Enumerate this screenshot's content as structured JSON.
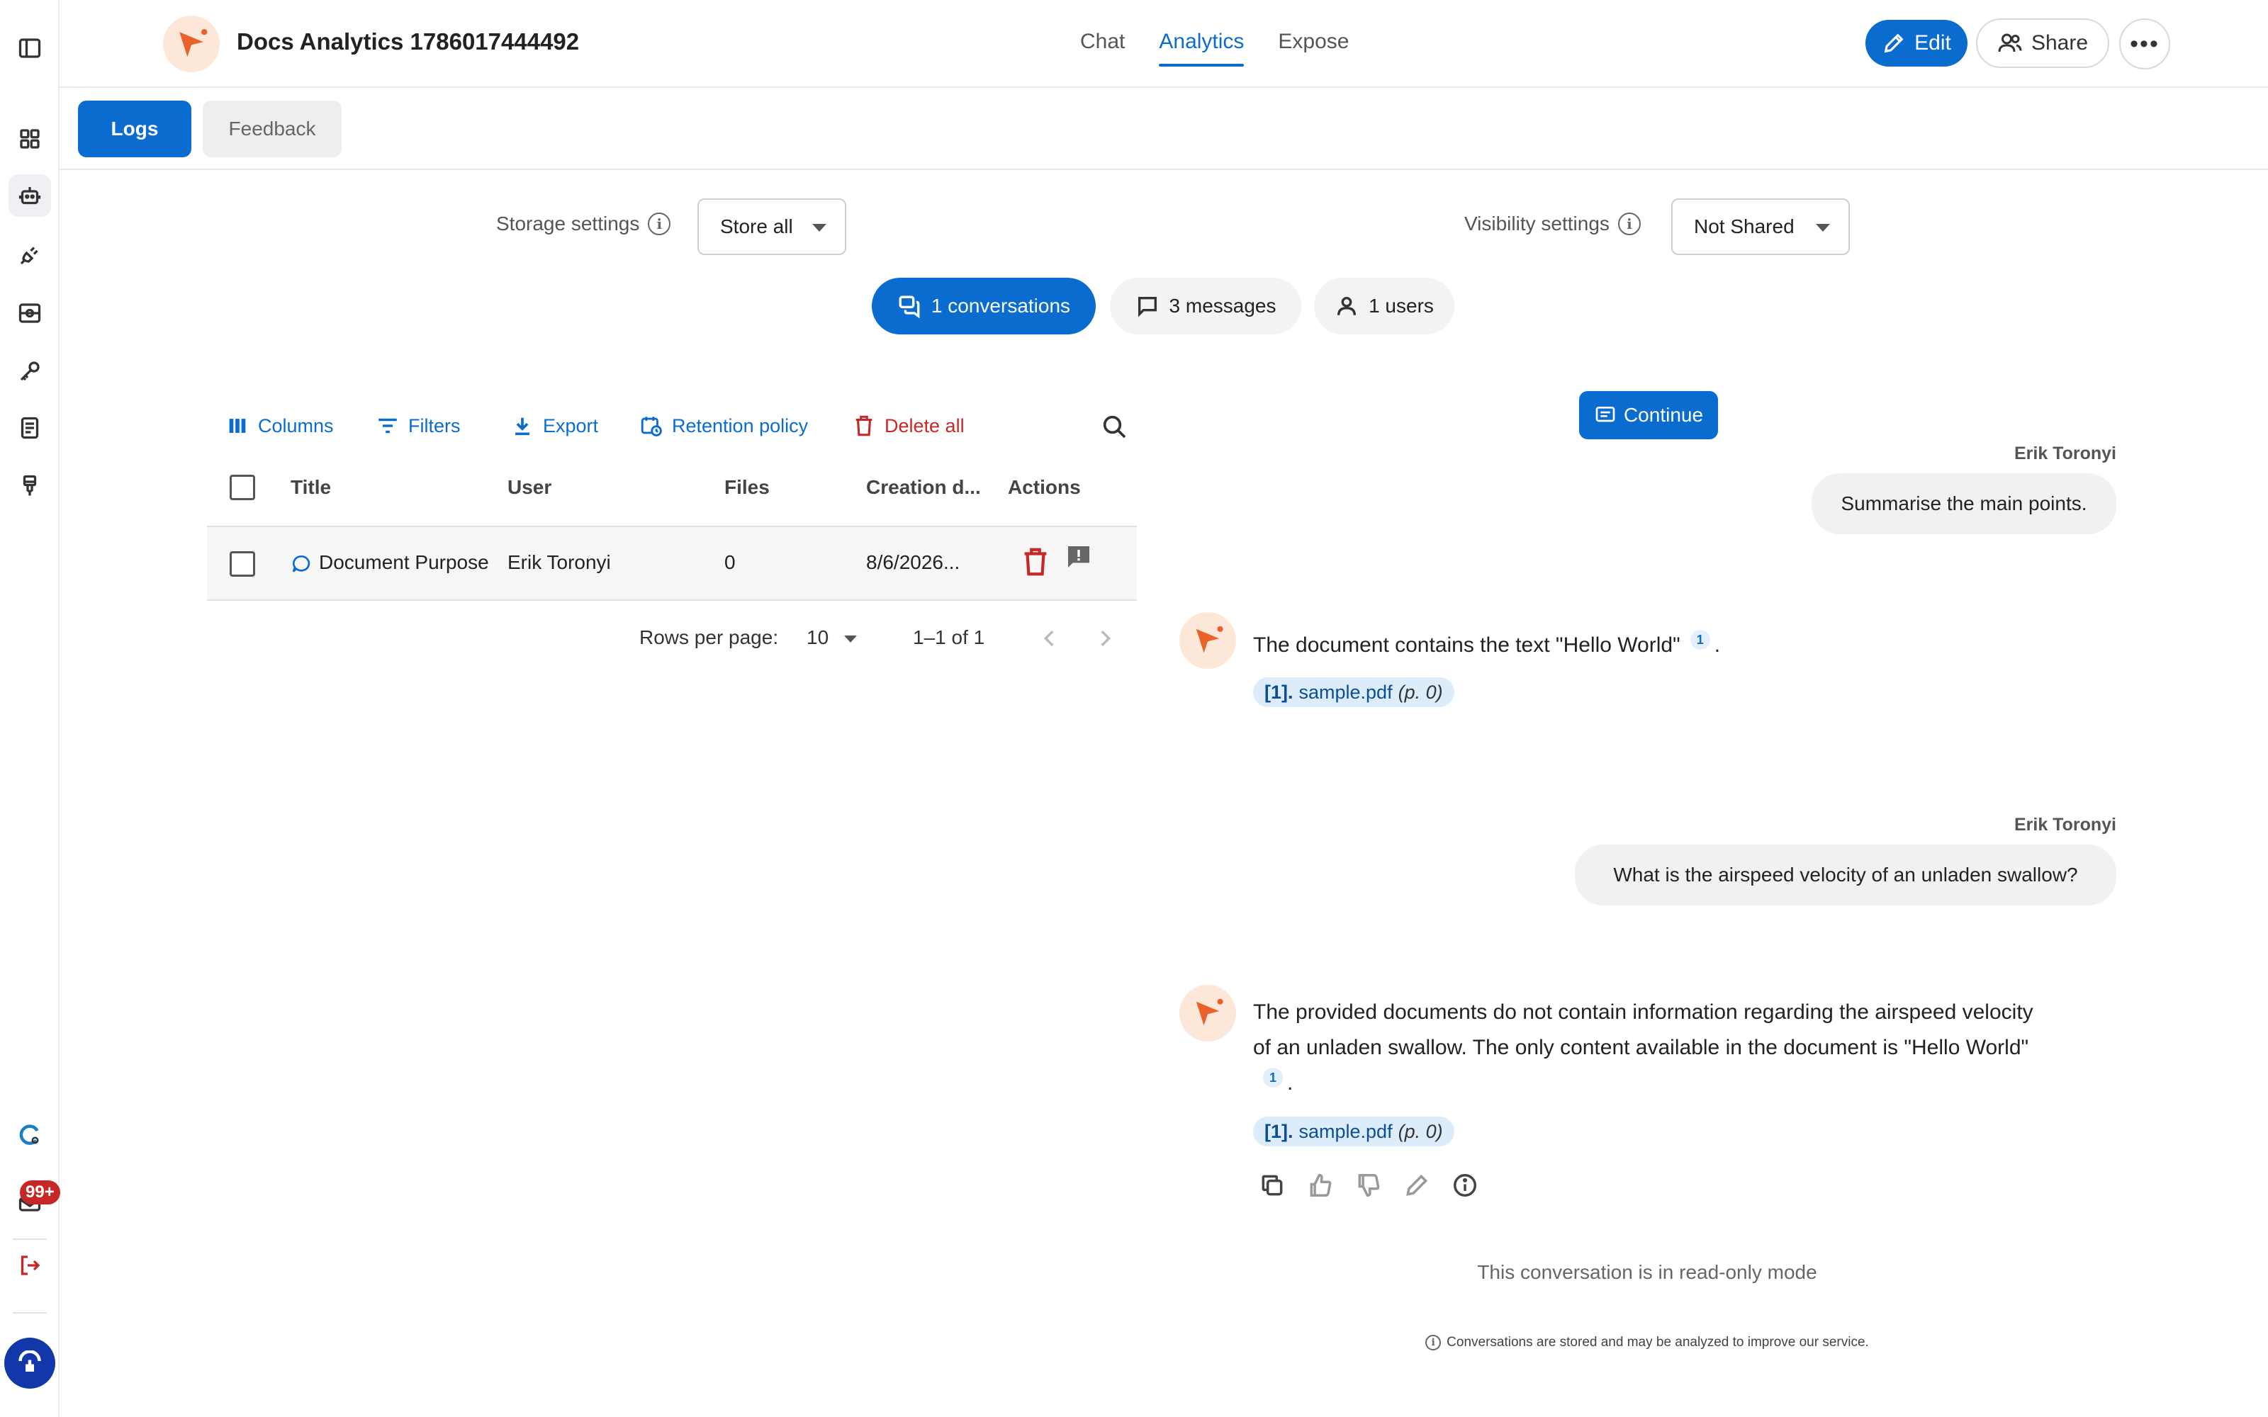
{
  "app": {
    "title": "Docs Analytics 1786017444492",
    "nav_tabs": [
      {
        "label": "Chat"
      },
      {
        "label": "Analytics",
        "active": true
      },
      {
        "label": "Expose"
      }
    ],
    "edit_label": "Edit",
    "share_label": "Share"
  },
  "rail": {
    "notification_badge": "99+"
  },
  "subtabs": {
    "logs": "Logs",
    "feedback": "Feedback"
  },
  "settings": {
    "storage_label": "Storage settings",
    "storage_value": "Store all",
    "visibility_label": "Visibility settings",
    "visibility_value": "Not Shared"
  },
  "stats": {
    "conversations": "1 conversations",
    "messages": "3 messages",
    "users": "1 users"
  },
  "toolbar": {
    "columns": "Columns",
    "filters": "Filters",
    "export": "Export",
    "retention": "Retention policy",
    "delete_all": "Delete all"
  },
  "table": {
    "headers": {
      "title": "Title",
      "user": "User",
      "files": "Files",
      "creation": "Creation d...",
      "actions": "Actions"
    },
    "rows": [
      {
        "title": "Document Purpose",
        "user": "Erik Toronyi",
        "files": "0",
        "creation": "8/6/2026..."
      }
    ],
    "rows_per_page_label": "Rows per page:",
    "rows_per_page": "10",
    "range": "1–1 of 1"
  },
  "chat": {
    "continue_label": "Continue",
    "messages": [
      {
        "role": "user",
        "name": "Erik Toronyi",
        "text": "Summarise the main points."
      },
      {
        "role": "bot",
        "text": "The document contains the text \"Hello World\"",
        "cite": "1",
        "source_ref": "[1].",
        "source_file": "sample.pdf",
        "source_page": "(p. 0)"
      },
      {
        "role": "user",
        "name": "Erik Toronyi",
        "text": "What is the airspeed velocity of an unladen swallow?"
      },
      {
        "role": "bot",
        "text": "The provided documents do not contain information regarding the airspeed velocity of an unladen swallow. The only content available in the document is \"Hello World\"",
        "cite": "1",
        "source_ref": "[1].",
        "source_file": "sample.pdf",
        "source_page": "(p. 0)"
      }
    ],
    "readonly_notice": "This conversation is in read-only mode",
    "footnote": "Conversations are stored and may be analyzed to improve our service."
  },
  "colors": {
    "primary": "#0a6ccf",
    "danger": "#c62828",
    "brand_orange": "#e8622a"
  }
}
